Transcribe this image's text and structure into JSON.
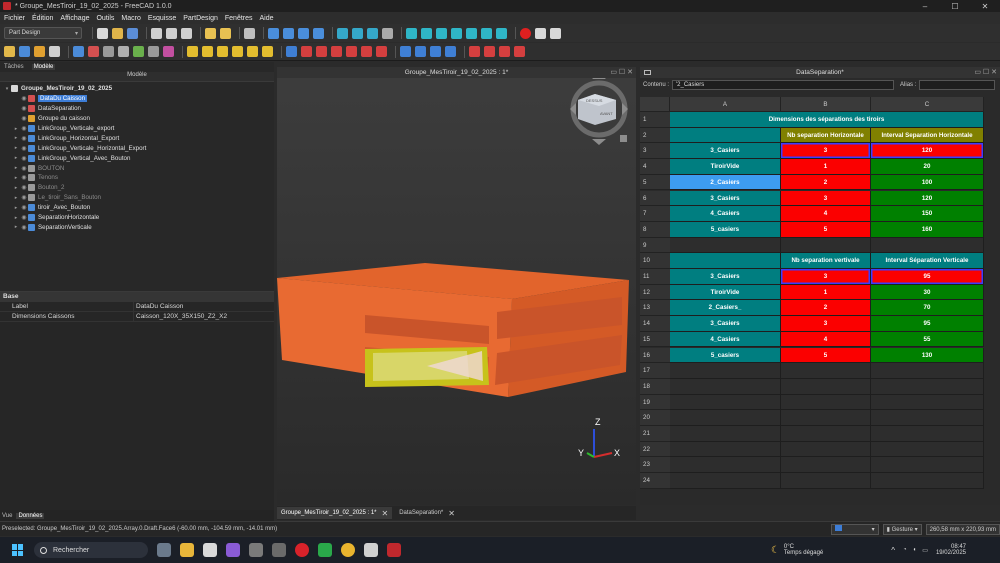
{
  "window": {
    "title": "* Groupe_MesTiroir_19_02_2025 - FreeCAD 1.0.0"
  },
  "menu": [
    "Fichier",
    "Édition",
    "Affichage",
    "Outils",
    "Macro",
    "Esquisse",
    "PartDesign",
    "Fenêtres",
    "Aide"
  ],
  "workbench": {
    "selected": "Part Design"
  },
  "left_panel": {
    "tabs": [
      "Tâches",
      "Modèle"
    ],
    "active_tab": "Modèle",
    "header": "Modèle",
    "tree": [
      {
        "label": "Groupe_MesTiroir_19_02_2025",
        "level": 0,
        "bold": true
      },
      {
        "label": "DataDu Caisson",
        "level": 1,
        "selected": true
      },
      {
        "label": "DataSeparation",
        "level": 1
      },
      {
        "label": "Groupe du caisson",
        "level": 1
      },
      {
        "label": "LinkGroup_Verticale_export",
        "level": 1
      },
      {
        "label": "LinkGroup_Horizontal_Export",
        "level": 1
      },
      {
        "label": "LinkGroup_Verticale_Horizontal_Export",
        "level": 1
      },
      {
        "label": "LinkGroup_Vertical_Avec_Bouton",
        "level": 1
      },
      {
        "label": "BOUTON",
        "level": 1,
        "dim": true
      },
      {
        "label": "Tenons",
        "level": 1,
        "dim": true
      },
      {
        "label": "Bouton_2",
        "level": 1,
        "dim": true
      },
      {
        "label": "Le_tiroir_Sans_Bouton",
        "level": 1,
        "dim": true
      },
      {
        "label": "tiroir_Avec_Bouton",
        "level": 1
      },
      {
        "label": "SeparationHorizontale",
        "level": 1
      },
      {
        "label": "SeparationVerticale",
        "level": 1
      }
    ],
    "property_group": "Base",
    "properties": [
      {
        "key": "Label",
        "value": "DataDu Caisson"
      },
      {
        "key": "Dimensions Caissons",
        "value": "Caisson_120X_35X150_Z2_X2"
      }
    ],
    "bottom_tabs": [
      "Vue",
      "Données"
    ],
    "active_bottom_tab": "Données"
  },
  "view3d": {
    "title": "Groupe_MesTiroir_19_02_2025 : 1*",
    "navcube": {
      "top": "DESSUS",
      "front": "AVANT"
    },
    "axes": {
      "x": "X",
      "y": "Y",
      "z": "Z"
    }
  },
  "doc_tabs": [
    {
      "label": "Groupe_MesTiroir_19_02_2025 : 1*",
      "active": true
    },
    {
      "label": "DataSeparation*",
      "active": false
    }
  ],
  "sheet": {
    "title": "DataSeparation*",
    "content_label": "Contenu :",
    "content_value": "'2_Casiers",
    "alias_label": "Alias :",
    "columns": [
      "A",
      "B",
      "C"
    ],
    "rows": [
      {
        "n": "1",
        "cells": [
          {
            "t": "Dimensions des séparations des tiroirs",
            "span": 3,
            "c": "teal"
          }
        ]
      },
      {
        "n": "2",
        "cells": [
          {
            "t": "",
            "c": "teal"
          },
          {
            "t": "Nb separation Horizontale",
            "c": "olive"
          },
          {
            "t": "Interval  Separation Horizontale",
            "c": "olive"
          }
        ]
      },
      {
        "n": "3",
        "cells": [
          {
            "t": "3_Casiers",
            "c": "teal"
          },
          {
            "t": "3",
            "c": "red",
            "frame": true
          },
          {
            "t": "120",
            "c": "red",
            "frame": true
          }
        ]
      },
      {
        "n": "4",
        "cells": [
          {
            "t": "TiroirVide",
            "c": "teal"
          },
          {
            "t": "1",
            "c": "red"
          },
          {
            "t": "20",
            "c": "green"
          }
        ]
      },
      {
        "n": "5",
        "cells": [
          {
            "t": "2_Casiers",
            "c": "sel"
          },
          {
            "t": "2",
            "c": "red"
          },
          {
            "t": "100",
            "c": "green"
          }
        ]
      },
      {
        "n": "6",
        "cells": [
          {
            "t": "3_Casiers",
            "c": "teal"
          },
          {
            "t": "3",
            "c": "red"
          },
          {
            "t": "120",
            "c": "green"
          }
        ]
      },
      {
        "n": "7",
        "cells": [
          {
            "t": "4_Casiers",
            "c": "teal"
          },
          {
            "t": "4",
            "c": "red"
          },
          {
            "t": "150",
            "c": "green"
          }
        ]
      },
      {
        "n": "8",
        "cells": [
          {
            "t": "5_casiers",
            "c": "teal"
          },
          {
            "t": "5",
            "c": "red"
          },
          {
            "t": "160",
            "c": "green"
          }
        ]
      },
      {
        "n": "9",
        "cells": [
          {
            "t": "",
            "c": "empty"
          },
          {
            "t": "",
            "c": "empty"
          },
          {
            "t": "",
            "c": "empty"
          }
        ]
      },
      {
        "n": "10",
        "cells": [
          {
            "t": "",
            "c": "teal"
          },
          {
            "t": "Nb separation vertivale",
            "c": "teal"
          },
          {
            "t": "Interval Séparation Verticale",
            "c": "teal"
          }
        ]
      },
      {
        "n": "11",
        "cells": [
          {
            "t": "3_Casiers",
            "c": "teal"
          },
          {
            "t": "3",
            "c": "red",
            "frame": true
          },
          {
            "t": "95",
            "c": "red",
            "frame": true
          }
        ]
      },
      {
        "n": "12",
        "cells": [
          {
            "t": "TiroirVide",
            "c": "teal"
          },
          {
            "t": "1",
            "c": "red"
          },
          {
            "t": "30",
            "c": "green"
          }
        ]
      },
      {
        "n": "13",
        "cells": [
          {
            "t": "2_Casiers_",
            "c": "teal"
          },
          {
            "t": "2",
            "c": "red"
          },
          {
            "t": "70",
            "c": "green"
          }
        ]
      },
      {
        "n": "14",
        "cells": [
          {
            "t": "3_Casiers",
            "c": "teal"
          },
          {
            "t": "3",
            "c": "red"
          },
          {
            "t": "95",
            "c": "green"
          }
        ]
      },
      {
        "n": "15",
        "cells": [
          {
            "t": "4_Casiers",
            "c": "teal"
          },
          {
            "t": "4",
            "c": "red"
          },
          {
            "t": "55",
            "c": "green"
          }
        ]
      },
      {
        "n": "16",
        "cells": [
          {
            "t": "5_casiers",
            "c": "teal"
          },
          {
            "t": "5",
            "c": "red"
          },
          {
            "t": "130",
            "c": "green"
          }
        ]
      },
      {
        "n": "17",
        "cells": []
      },
      {
        "n": "18",
        "cells": []
      },
      {
        "n": "19",
        "cells": []
      },
      {
        "n": "20",
        "cells": []
      },
      {
        "n": "21",
        "cells": []
      },
      {
        "n": "22",
        "cells": []
      },
      {
        "n": "23",
        "cells": []
      },
      {
        "n": "24",
        "cells": []
      }
    ]
  },
  "status": {
    "message": "Preselected: Groupe_MesTiroir_19_02_2025.Array.0.Draft.Face6 (-60.00 mm, -104.59 mm, -14.01 mm)",
    "nav_style": "Gesture",
    "dimensions": "260,58 mm x 220,93 mm"
  },
  "taskbar": {
    "search": "Rechercher",
    "weather_temp": "0°C",
    "weather_desc": "Temps dégagé",
    "time": "08:47",
    "date": "19/02/2025"
  },
  "colors": {
    "teal": "#007e80",
    "red": "#fb0000",
    "green": "#008000",
    "olive": "#808000",
    "selection": "#3d7dd6",
    "model": "#e05a28"
  }
}
